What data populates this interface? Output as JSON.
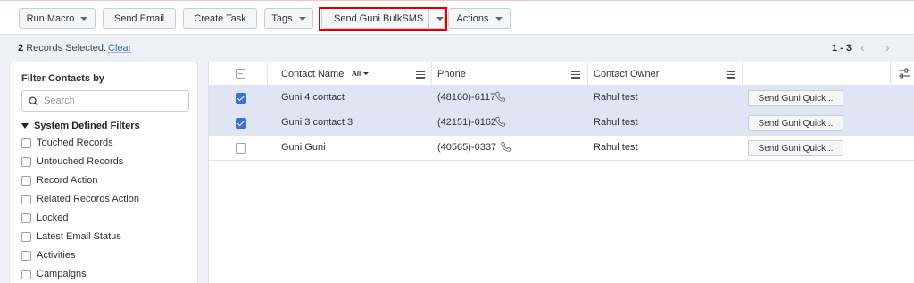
{
  "toolbar": {
    "run_macro": "Run Macro",
    "send_email": "Send Email",
    "create_task": "Create Task",
    "tags": "Tags",
    "send_guni_bulksms": "Send Guni BulkSMS",
    "actions": "Actions"
  },
  "selection": {
    "count": "2",
    "text": "Records Selected.",
    "clear": "Clear"
  },
  "pagination": {
    "range": "1 - 3",
    "prev_icon": "chevron-left-icon",
    "next_icon": "chevron-right-icon"
  },
  "filter_panel": {
    "title": "Filter Contacts by",
    "search_placeholder": "Search",
    "section_title": "System Defined Filters",
    "items": [
      "Touched Records",
      "Untouched Records",
      "Record Action",
      "Related Records Action",
      "Locked",
      "Latest Email Status",
      "Activities",
      "Campaigns"
    ]
  },
  "table": {
    "columns": {
      "contact_name": "Contact Name",
      "all_filter": "All",
      "phone": "Phone",
      "contact_owner": "Contact Owner"
    },
    "rows": [
      {
        "name": "Guni 4 contact",
        "phone": "(48160)-6117",
        "owner": "Rahul test",
        "action": "Send Guni Quick...",
        "checked": true
      },
      {
        "name": "Guni 3 contact 3",
        "phone": "(42151)-0162",
        "owner": "Rahul test",
        "action": "Send Guni Quick...",
        "checked": true
      },
      {
        "name": "Guni Guni",
        "phone": "(40565)-0337",
        "owner": "Rahul test",
        "action": "Send Guni Quick...",
        "checked": false
      }
    ]
  },
  "colors": {
    "highlight": "#e00000",
    "selected_row": "#dfe5f5",
    "checkbox_checked": "#3b6fd8",
    "link": "#3a6bc9"
  }
}
